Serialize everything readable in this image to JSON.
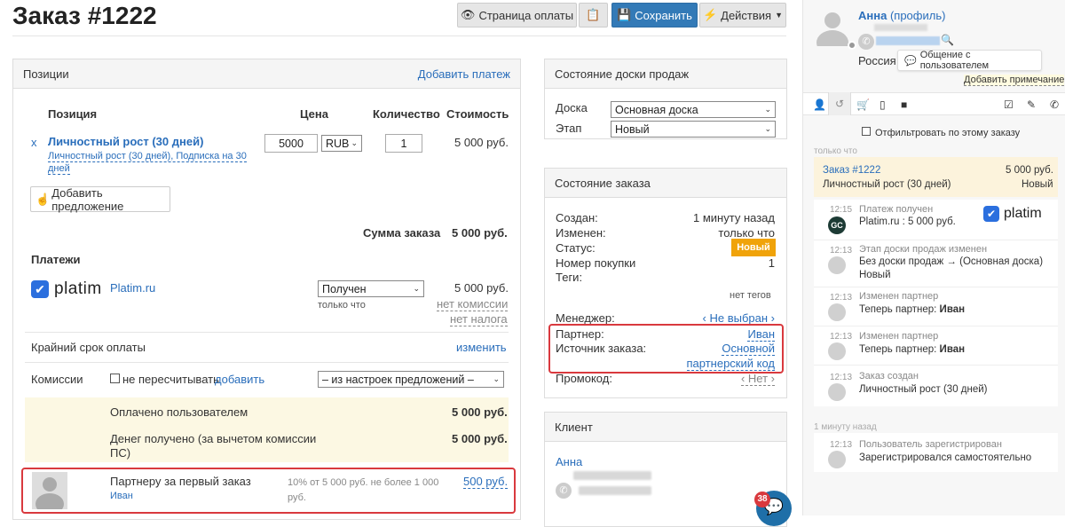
{
  "header": {
    "title": "Заказ #1222",
    "pay_page": "Страница оплаты",
    "save": "Сохранить",
    "actions": "Действия"
  },
  "positions": {
    "panel_title": "Позиции",
    "add_payment": "Добавить платеж",
    "col_item": "Позиция",
    "col_price": "Цена",
    "col_qty": "Количество",
    "col_cost": "Стоимость",
    "item": {
      "remove": "x",
      "name": "Личностный рост (30 дней)",
      "sub1": "Личностный рост (30 дней), Подписка на 30",
      "sub2": "дней",
      "price": "5000",
      "currency": "RUB",
      "qty": "1",
      "cost": "5 000 руб."
    },
    "add_offer": "Добавить предложение",
    "sum_label": "Сумма заказа",
    "sum_value": "5 000 руб.",
    "payments_title": "Платежи",
    "platim_logo": "platim",
    "payment_system": "Platim.ru",
    "payment_status": "Получен",
    "payment_time": "только что",
    "payment_amount": "5 000 руб.",
    "no_commission": "нет комиссии",
    "no_tax": "нет налога",
    "deadline_label": "Крайний срок оплаты",
    "deadline_change": "изменить",
    "commissions_label": "Комиссии",
    "no_recalc": "не пересчитывать",
    "add": "добавить",
    "commission_select": "– из настроек предложений –",
    "paid_label": "Оплачено пользователем",
    "paid_value": "5 000 руб.",
    "received_label1": "Денег получено (за вычетом комиссии",
    "received_label2": "ПС)",
    "received_value": "5 000 руб.",
    "partner_label": "Партнеру за первый заказ",
    "partner_name": "Иван",
    "partner_calc1": "10% от 5 000 руб. не более 1 000",
    "partner_calc2": "руб.",
    "partner_value": "500 руб."
  },
  "board": {
    "title": "Состояние доски продаж",
    "board_label": "Доска",
    "board_value": "Основная доска",
    "stage_label": "Этап",
    "stage_value": "Новый"
  },
  "order_state": {
    "title": "Состояние заказа",
    "created_label": "Создан:",
    "created_value": "1 минуту назад",
    "changed_label": "Изменен:",
    "changed_value": "только что",
    "status_label": "Статус:",
    "status_value": "Новый",
    "purchase_label": "Номер покупки",
    "purchase_value": "1",
    "tags_label": "Теги:",
    "tags_value": "нет тегов",
    "manager_label": "Менеджер:",
    "manager_value": "‹ Не выбран ›",
    "partner_label": "Партнер:",
    "partner_value": "Иван",
    "source_label": "Источник заказа:",
    "source_value1": "Основной",
    "source_value2": "партнерский код",
    "promo_label": "Промокод:",
    "promo_value": "‹ Нет ›"
  },
  "client": {
    "title": "Клиент",
    "name": "Анна"
  },
  "chat_badge": "38",
  "sidebar": {
    "name": "Анна",
    "profile": "(профиль)",
    "country": "Россия",
    "chat_button": "Общение с пользователем",
    "add_note": "Добавить примечание",
    "filter_label": "Отфильтровать по этому заказу",
    "group1": "только что",
    "order_card": {
      "title": "Заказ #1222",
      "amount": "5 000 руб.",
      "item": "Личностный рост (30 дней)",
      "status": "Новый"
    },
    "events": [
      {
        "time": "12:15",
        "head": "Платеж получен",
        "body": "Platim.ru : 5 000 руб."
      },
      {
        "time": "12:13",
        "head": "Этап доски продаж изменен",
        "body": "Без доски продаж → (Основная доска)",
        "body2": "Новый"
      },
      {
        "time": "12:13",
        "head": "Изменен партнер",
        "body": "Теперь партнер: ",
        "bold": "Иван"
      },
      {
        "time": "12:13",
        "head": "Изменен партнер",
        "body": "Теперь партнер: ",
        "bold": "Иван"
      },
      {
        "time": "12:13",
        "head": "Заказ создан",
        "body": "Личностный рост (30 дней)"
      }
    ],
    "group2": "1 минуту назад",
    "event_reg": {
      "time": "12:13",
      "head": "Пользователь зарегистрирован",
      "body": "Зарегистрировался самостоятельно"
    },
    "platim_logo": "platim"
  }
}
